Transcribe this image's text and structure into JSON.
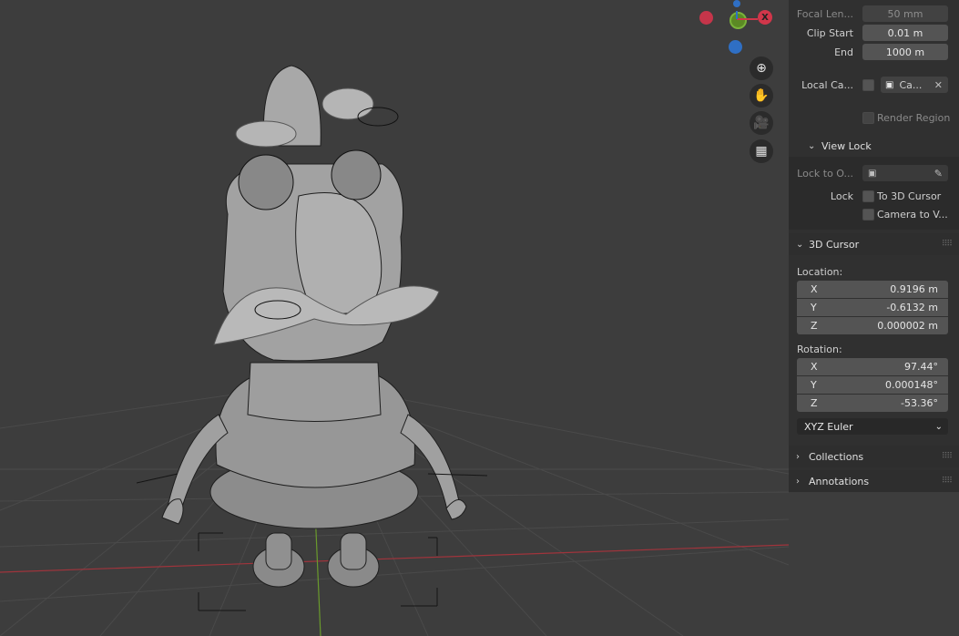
{
  "gizmo": {
    "colors": {
      "x_red": "#d1364a",
      "y_green": "#7ab33a",
      "z_blue": "#2f6fc4"
    },
    "x_label": "X",
    "buttons": [
      "zoom-icon",
      "hand-pan-icon",
      "camera-icon",
      "ortho-grid-icon"
    ]
  },
  "view": {
    "focal_length_label": "Focal Len...",
    "focal_length_value": "50 mm",
    "clip_start_label": "Clip Start",
    "clip_start_value": "0.01 m",
    "clip_end_label": "End",
    "clip_end_value": "1000 m",
    "local_camera_label": "Local Ca...",
    "local_camera_value": "Ca...",
    "render_region_label": "Render Region"
  },
  "view_lock": {
    "title": "View Lock",
    "lock_to_object_label": "Lock to O...",
    "lock_label": "Lock",
    "to_3d_cursor_label": "To 3D Cursor",
    "camera_to_view_label": "Camera to V..."
  },
  "cursor_3d": {
    "title": "3D Cursor",
    "location_label": "Location:",
    "location": [
      {
        "axis": "X",
        "value": "0.9196 m"
      },
      {
        "axis": "Y",
        "value": "-0.6132 m"
      },
      {
        "axis": "Z",
        "value": "0.000002 m"
      }
    ],
    "rotation_label": "Rotation:",
    "rotation": [
      {
        "axis": "X",
        "value": "97.44°"
      },
      {
        "axis": "Y",
        "value": "0.000148°"
      },
      {
        "axis": "Z",
        "value": "-53.36°"
      }
    ],
    "rotation_mode": "XYZ Euler"
  },
  "sections": {
    "collections": "Collections",
    "annotations": "Annotations"
  },
  "colors": {
    "viewport_bg": "#3d3d3d",
    "panel_bg": "#303030",
    "field_bg": "#545454",
    "x_axis_line": "#a0343c",
    "y_axis_line": "#6a9a2c"
  }
}
